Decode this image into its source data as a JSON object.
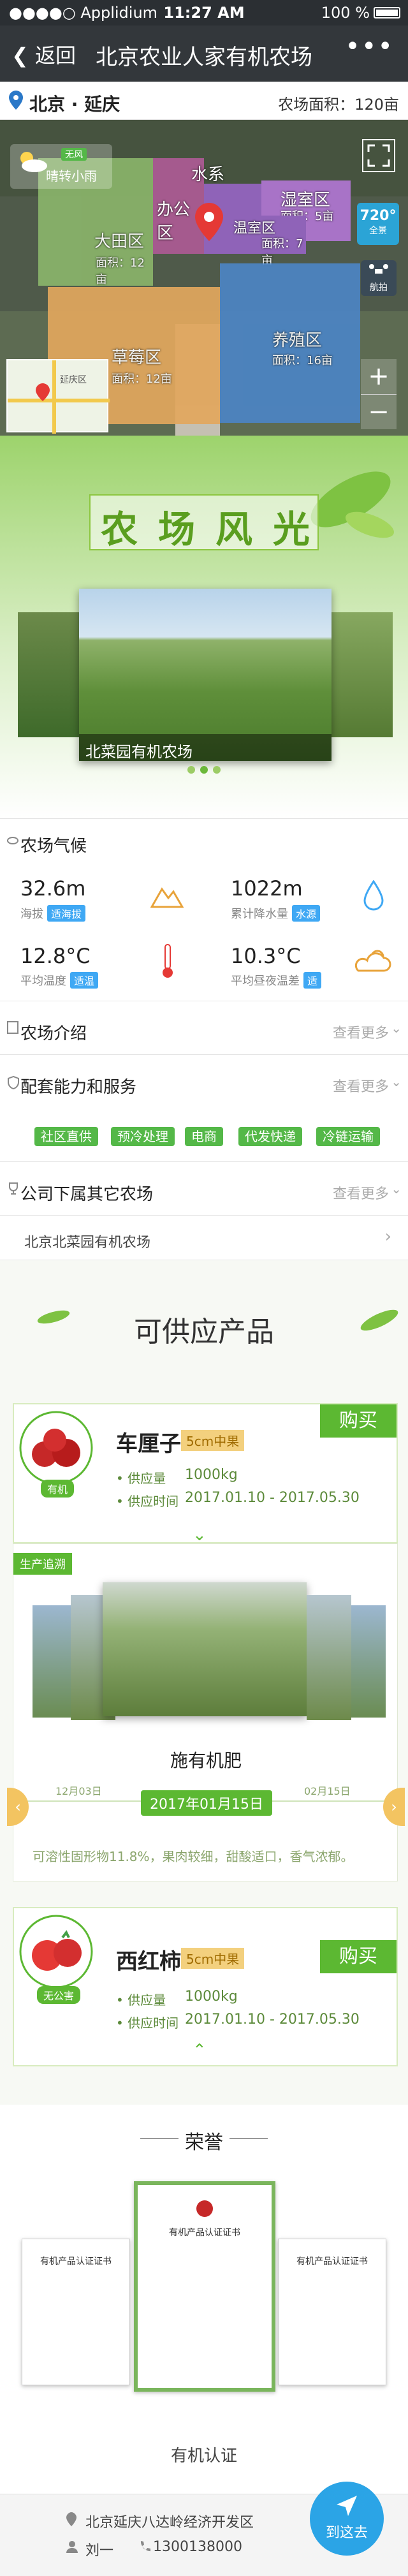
{
  "status_bar": {
    "carrier": "●●●●○ Applidium",
    "time": "11:27 AM",
    "battery": "100 %"
  },
  "nav": {
    "back_label": "返回",
    "title": "北京农业人家有机农场",
    "more": "•••"
  },
  "location": {
    "city": "北京 · 延庆",
    "area_label": "农场面积：120亩"
  },
  "map": {
    "weather_badge": "无风",
    "weather_text": "晴转小雨",
    "fields": [
      {
        "name": "大田区",
        "area": "面积：12亩"
      },
      {
        "name": "办公区",
        "area": ""
      },
      {
        "name": "湿室区",
        "area": "面积：5亩"
      },
      {
        "name": "温室区",
        "area": "面积：7亩"
      },
      {
        "name": "草莓区",
        "area": "面积：12亩"
      },
      {
        "name": "养殖区",
        "area": "面积：16亩"
      },
      {
        "name": "水系",
        "area": ""
      }
    ],
    "panorama_value": "720°",
    "panorama_label": "全景",
    "camera_label": "航拍",
    "zoom_in": "+",
    "zoom_out": "−",
    "minimap_label": "延庆区"
  },
  "scenery": {
    "title_chars": [
      "农",
      "场",
      "风",
      "光"
    ],
    "photo_caption": "北菜园有机农场"
  },
  "weather": {
    "title": "农场气候",
    "stats": [
      {
        "value": "32.6m",
        "label": "海拔",
        "tag": "适海拔"
      },
      {
        "value": "1022m",
        "label": "累计降水量",
        "tag": "水源"
      },
      {
        "value": "12.8°C",
        "label": "平均温度",
        "tag": "适温"
      },
      {
        "value": "10.3°C",
        "label": "平均昼夜温差",
        "tag": "适"
      }
    ]
  },
  "intro": {
    "title": "农场介绍",
    "more": "查看更多"
  },
  "services": {
    "title": "配套能力和服务",
    "more": "查看更多",
    "tags": [
      "社区直供",
      "预冷处理",
      "电商",
      "代发快递",
      "冷链运输"
    ]
  },
  "company": {
    "title": "公司下属其它农场",
    "more": "查看更多",
    "item": "北京北菜园有机农场"
  },
  "products": {
    "section_title": "可供应产品",
    "items": [
      {
        "name": "车厘子",
        "size": "5cm中果",
        "buy": "购买",
        "badge": "有机",
        "supply_label": "供应量",
        "supply_value": "1000kg",
        "time_label": "供应时间",
        "time_value": "2017.01.10 - 2017.05.30"
      },
      {
        "name": "西红柿",
        "size": "5cm中果",
        "buy": "购买",
        "badge": "无公害",
        "supply_label": "供应量",
        "supply_value": "1000kg",
        "time_label": "供应时间",
        "time_value": "2017.01.10 - 2017.05.30"
      }
    ],
    "traceability": {
      "label": "生产追溯",
      "step": "施有机肥",
      "date": "2017年01月15日",
      "timeline_left": "12月03日",
      "timeline_right": "02月15日",
      "description": "可溶性固形物11.8%，果肉较细，甜酸适口，香气浓郁。"
    }
  },
  "honor": {
    "title": "荣誉",
    "cert_title_left": "有机产品认证证书",
    "cert_title_center": "有机产品认证证书",
    "cert_title_right": "有机产品认证证书",
    "cert_label": "有机认证"
  },
  "footer": {
    "address": "北京延庆八达岭经济开发区",
    "contact": "刘一",
    "phone": "1300138000",
    "go_label": "到这去"
  }
}
